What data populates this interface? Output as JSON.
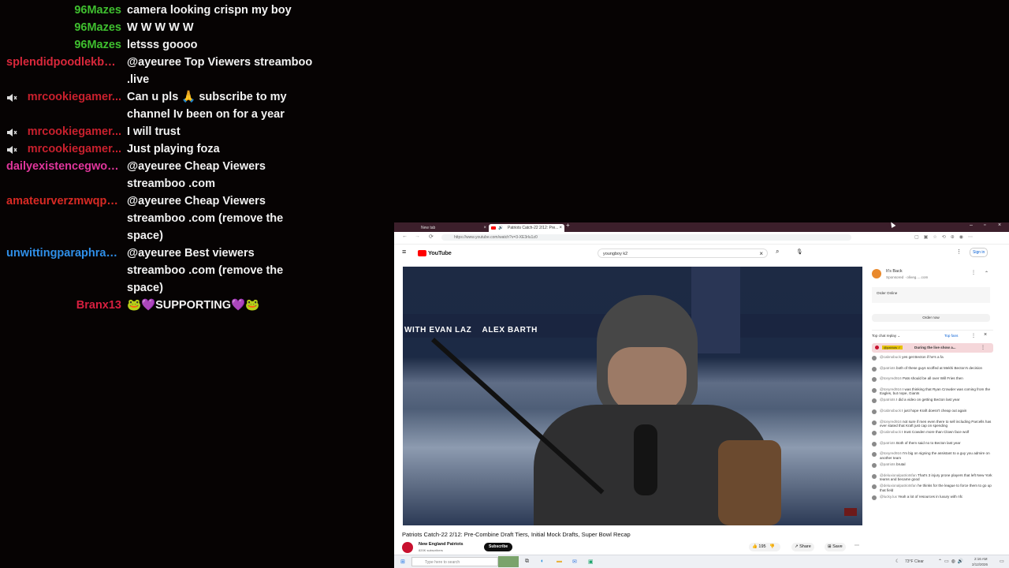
{
  "chat": {
    "messages": [
      {
        "user": "96Mazes",
        "color": "#3fbf2f",
        "text": "camera looking crispn my boy",
        "muted": false
      },
      {
        "user": "96Mazes",
        "color": "#3fbf2f",
        "text": "W W W W W",
        "muted": false
      },
      {
        "user": "96Mazes",
        "color": "#3fbf2f",
        "text": "letsss goooo",
        "muted": false
      },
      {
        "user": "splendidpoodlekbm...",
        "color": "#d9283b",
        "text": "@ayeuree Top Viewers streamboo .live",
        "muted": false
      },
      {
        "user": "mrcookiegamer...",
        "color": "#c8202d",
        "text": "Can u pls 🙏 subscribe to my channel Iv been on for a year",
        "muted": true
      },
      {
        "user": "mrcookiegamer...",
        "color": "#c8202d",
        "text": "I will trust",
        "muted": true
      },
      {
        "user": "mrcookiegamer...",
        "color": "#c8202d",
        "text": "Just playing foza",
        "muted": true
      },
      {
        "user": "dailyexistencegwo5...",
        "color": "#e0369c",
        "text": "@ayeuree Cheap Viewers streamboo .com",
        "muted": false
      },
      {
        "user": "amateurverzmwqp2...",
        "color": "#d82a24",
        "text": "@ayeuree Cheap Viewers streamboo .com (remove the space)",
        "muted": false
      },
      {
        "user": "unwittingparaphras...",
        "color": "#2f8fe8",
        "text": "@ayeuree Best viewers streamboo .com (remove the space)",
        "muted": false
      },
      {
        "user": "Branx13",
        "color": "#d61f3f",
        "text": "🐸💜SUPPORTING💜🐸",
        "muted": false
      }
    ]
  },
  "browser": {
    "tabs": [
      "New tab",
      "Patriots Catch-22 2/12: Pre..."
    ],
    "url": "https://www.youtube.com/watch?v=3-XE3rlu1z0",
    "brand": "YouTube",
    "search_value": "youngboy k2",
    "sign_in": "Sign in",
    "video_overlay": "WITH EVAN LAZ    ALEX BARTH",
    "video_title": "Patriots Catch-22 2/12: Pre-Combine Draft Tiers, Initial Mock Drafts, Super Bowl Recap",
    "channel_name": "New England Patriots",
    "channel_subs": "820K subscribers",
    "subscribe_label": "Subscribe",
    "likes": "195",
    "share_label": "Share",
    "save_label": "Save",
    "ad": {
      "name": "It's Back",
      "sponsor": "Sponsored · oliveg.....com",
      "line": "Order Online",
      "button": "Order now"
    },
    "live_chat": {
      "header": "Top chat replay",
      "badge": "Top fans",
      "pinned": "During the live show a...",
      "comments": [
        {
          "user": "@cabnobuck",
          "text": "yes get Becton if he's a fa"
        },
        {
          "user": "@patriots",
          "text": "both of these guys scoffed at Mekhi Becton's decision"
        },
        {
          "user": "@tonyred916",
          "text": "Pats should be all over Will Fries then"
        },
        {
          "user": "@tonyred916",
          "text": "I was thinking that Ryan Crowder was coming from the Eagles, but nope, Giants"
        },
        {
          "user": "@patriots",
          "text": "I did a video on getting Becton last year"
        },
        {
          "user": "@cabnobuck",
          "text": "I just hope Kraft doesn't cheap out again"
        },
        {
          "user": "@tonyred916",
          "text": "not sure if men even there to sell including Parcells has ever stated that Kraft just cap on spending"
        },
        {
          "user": "@cabnobuck",
          "text": "I trust Cowden more than Clown face wolf"
        },
        {
          "user": "@patriots",
          "text": "Both of them said no to Becton last year"
        },
        {
          "user": "@tonyred916",
          "text": "I'm big on signing the assistant to a guy you admire on another team"
        },
        {
          "user": "@patriots",
          "text": "brutal"
        },
        {
          "user": "@deluxionalpatriotsfan",
          "text": "That's 3 injury prone players that left New York teams and became good"
        },
        {
          "user": "@deluxionalpatriotsfan",
          "text": "he thinks for the league to force them to go up that field"
        },
        {
          "user": "@lucky.lux",
          "text": "Yeah a lot of resources in luxury with nfc"
        }
      ]
    },
    "taskbar": {
      "search_placeholder": "Type here to search",
      "weather": "73°F Clear",
      "time": "2:16 AM",
      "date": "2/12/2026"
    }
  }
}
